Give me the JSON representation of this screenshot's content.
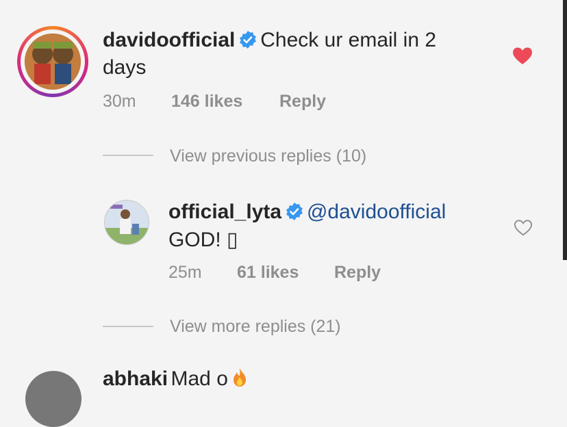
{
  "colors": {
    "like_red": "#ed4956",
    "verified_blue": "#3897f0",
    "link_blue": "#1d4f91",
    "meta_gray": "#8e8e8e"
  },
  "comment1": {
    "username": "davidoofficial",
    "text_line1": "Check ur email in 2",
    "text_line2": "days",
    "time": "30m",
    "likes": "146 likes",
    "reply": "Reply",
    "liked": true,
    "avatar_icon": "cartoon-avatar",
    "verified_icon": "verified-badge-icon",
    "like_icon": "heart-filled-icon"
  },
  "view_previous": "View previous replies (10)",
  "reply1": {
    "username": "official_lyta",
    "mention": "@davidoofficial",
    "text_line2": "GOD! ▯",
    "time": "25m",
    "likes": "61 likes",
    "reply": "Reply",
    "liked": false,
    "like_icon": "heart-outline-icon"
  },
  "view_more": "View more replies (21)",
  "comment2": {
    "username": "abhaki",
    "text": "Mad o",
    "emoji_icon": "fire-icon"
  }
}
